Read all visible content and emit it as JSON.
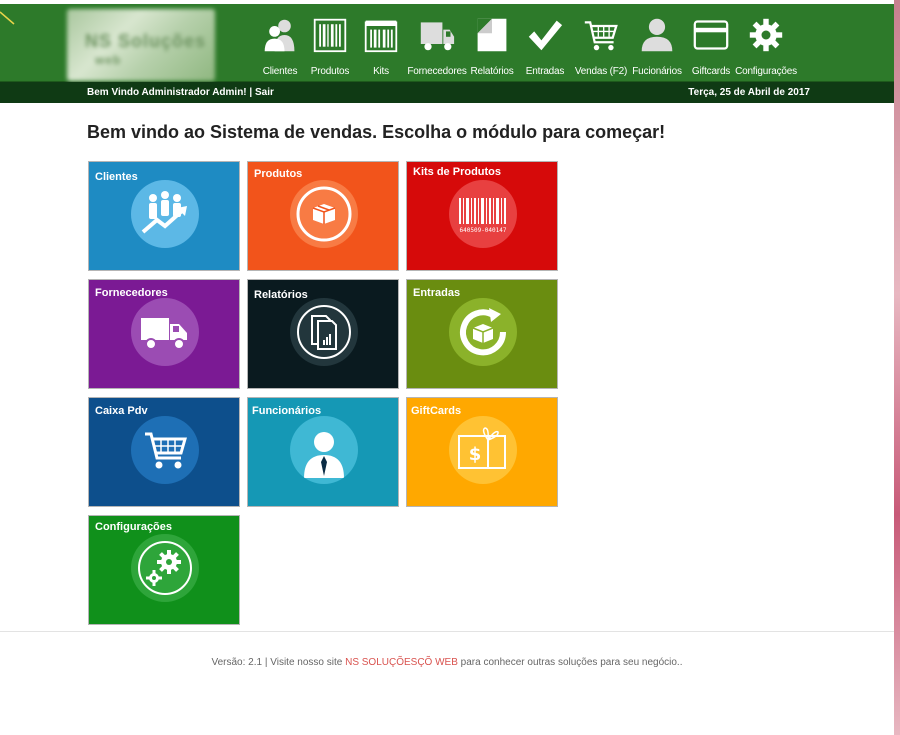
{
  "header": {
    "logo_alt": "NS Soluções Web"
  },
  "nav": [
    {
      "label": "Clientes",
      "icon": "users-icon"
    },
    {
      "label": "Produtos",
      "icon": "barcode-box-icon"
    },
    {
      "label": "Kits",
      "icon": "kits-icon"
    },
    {
      "label": "Fornecedores",
      "icon": "truck-icon"
    },
    {
      "label": "Relatórios",
      "icon": "document-icon"
    },
    {
      "label": "Entradas",
      "icon": "checkmark-icon"
    },
    {
      "label": "Vendas (F2)",
      "icon": "cart-icon"
    },
    {
      "label": "Fucionários",
      "icon": "person-icon"
    },
    {
      "label": "Giftcards",
      "icon": "card-icon"
    },
    {
      "label": "Configurações",
      "icon": "gear-icon"
    }
  ],
  "subbar": {
    "welcome": "Bem Vindo Administrador Admin!",
    "separator": " | ",
    "logout": "Sair",
    "date": "Terça, 25 de Abril de 2017"
  },
  "main": {
    "heading": "Bem vindo ao Sistema de vendas. Escolha o módulo para começar!",
    "tiles": [
      {
        "label": "Clientes",
        "color": "#1e8bc3",
        "icon": "growth-users-icon"
      },
      {
        "label": "Produtos",
        "color": "#f2541b",
        "icon": "box-icon"
      },
      {
        "label": "Kits de Produtos",
        "color": "#d60a0a",
        "icon": "barcode-icon",
        "barcode_text": "640509-040147"
      },
      {
        "label": "Fornecedores",
        "color": "#7b1a94",
        "icon": "truck-icon"
      },
      {
        "label": "Relatórios",
        "color": "#0a1a1f",
        "icon": "report-icon"
      },
      {
        "label": "Entradas",
        "color": "#6a8d10",
        "icon": "box-refresh-icon"
      },
      {
        "label": "Caixa Pdv",
        "color": "#0d4f8c",
        "icon": "cart-icon"
      },
      {
        "label": "Funcionários",
        "color": "#1598b5",
        "icon": "employee-icon"
      },
      {
        "label": "GiftCards",
        "color": "#ffa800",
        "icon": "giftcard-icon"
      },
      {
        "label": "Configurações",
        "color": "#10901b",
        "icon": "gears-icon"
      }
    ]
  },
  "footer": {
    "prefix": "Versão: 2.1 | Visite nosso site ",
    "link": "NS SOLUÇÕESÇÕ WEB",
    "suffix": " para conhecer outras soluções para seu negócio.."
  }
}
